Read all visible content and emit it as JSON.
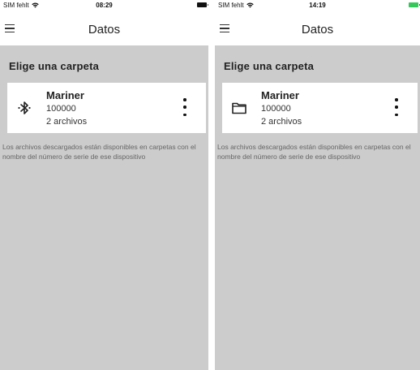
{
  "screens": [
    {
      "status": {
        "carrier": "SIM fehlt",
        "time": "08:29",
        "battery_color": "#111111"
      },
      "header": {
        "title": "Datos",
        "menu_icon": "hamburger-menu-icon"
      },
      "section_title": "Elige una carpeta",
      "folder": {
        "icon": "bluetooth-icon",
        "name": "Mariner",
        "serial": "100000",
        "count": "2 archivos",
        "more_icon": "more-vertical-icon"
      },
      "info_text": "Los archivos descargados están disponibles en carpetas con el nombre del número de serie de ese dispositivo"
    },
    {
      "status": {
        "carrier": "SIM fehlt",
        "time": "14:19",
        "battery_color": "#34c759"
      },
      "header": {
        "title": "Datos",
        "menu_icon": "hamburger-menu-icon"
      },
      "section_title": "Elige una carpeta",
      "folder": {
        "icon": "folder-icon",
        "name": "Mariner",
        "serial": "100000",
        "count": "2 archivos",
        "more_icon": "more-vertical-icon"
      },
      "info_text": "Los archivos descargados están disponibles en carpetas con el nombre del número de serie de ese dispositivo"
    }
  ]
}
